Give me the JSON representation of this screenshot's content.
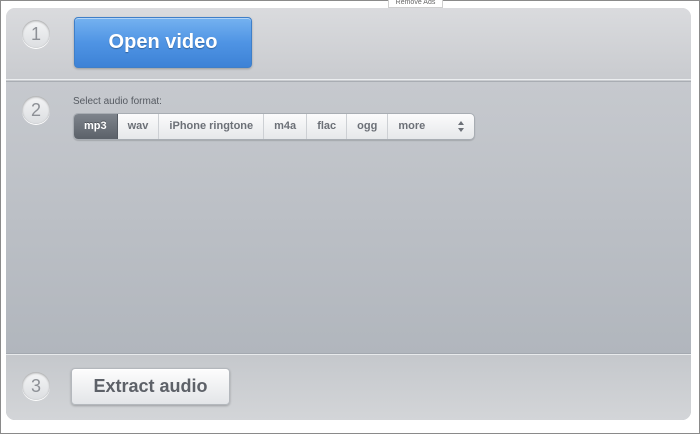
{
  "header": {
    "remove_ads_label": "Remove Ads"
  },
  "steps": {
    "step1": {
      "number": "1",
      "button_label": "Open video"
    },
    "step2": {
      "number": "2",
      "label": "Select audio format:",
      "formats": [
        "mp3",
        "wav",
        "iPhone ringtone",
        "m4a",
        "flac",
        "ogg"
      ],
      "selected": "mp3",
      "more_label": "more",
      "more_icon": "chevron-updown-icon"
    },
    "step3": {
      "number": "3",
      "button_label": "Extract audio"
    }
  },
  "colors": {
    "accent_blue": "#4f94e4",
    "selected_format": "#666c74",
    "panel_gray": "#b9bdc3"
  }
}
